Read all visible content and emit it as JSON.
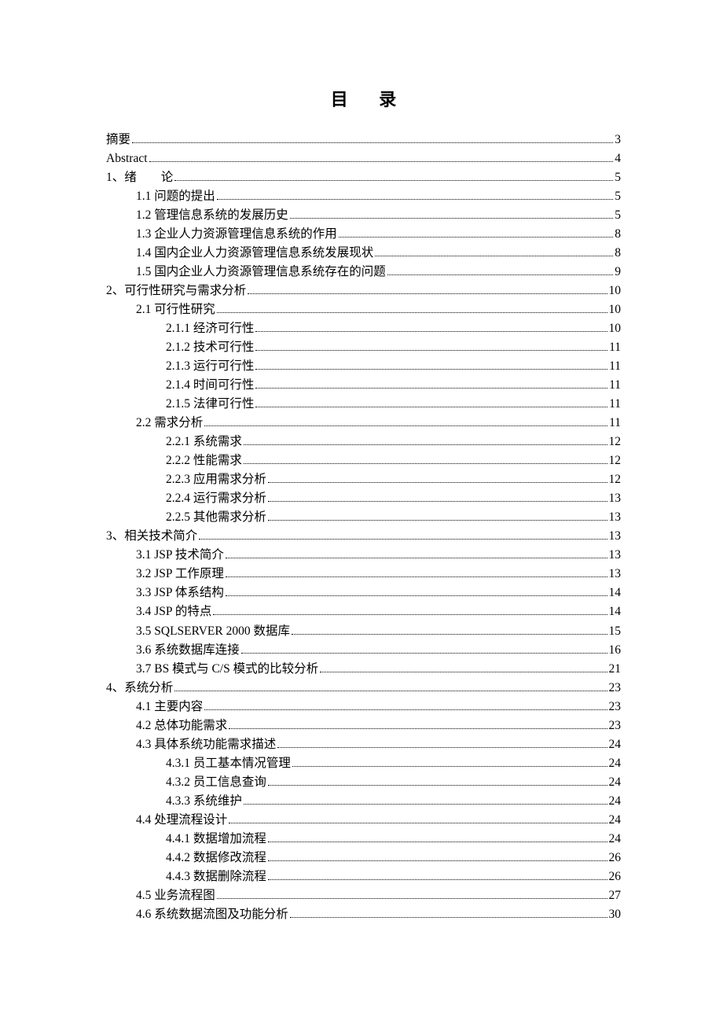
{
  "title": "目录",
  "entries": [
    {
      "label": "摘要",
      "page": "3",
      "level": 0
    },
    {
      "label": "Abstract",
      "page": "4",
      "level": 0
    },
    {
      "label": "1、绪　　论",
      "page": "5",
      "level": 0
    },
    {
      "label": "1.1  问题的提出",
      "page": "5",
      "level": 1
    },
    {
      "label": "1.2  管理信息系统的发展历史",
      "page": "5",
      "level": 1
    },
    {
      "label": "1.3  企业人力资源管理信息系统的作用",
      "page": "8",
      "level": 1
    },
    {
      "label": "1.4  国内企业人力资源管理信息系统发展现状",
      "page": "8",
      "level": 1
    },
    {
      "label": "1.5  国内企业人力资源管理信息系统存在的问题",
      "page": "9",
      "level": 1
    },
    {
      "label": "2、可行性研究与需求分析",
      "page": "10",
      "level": 0
    },
    {
      "label": "2.1  可行性研究",
      "page": "10",
      "level": 1
    },
    {
      "label": "2.1.1  经济可行性",
      "page": "10",
      "level": 2
    },
    {
      "label": "2.1.2  技术可行性",
      "page": "11",
      "level": 2
    },
    {
      "label": "2.1.3  运行可行性",
      "page": "11",
      "level": 2
    },
    {
      "label": "2.1.4  时间可行性",
      "page": "11",
      "level": 2
    },
    {
      "label": "2.1.5  法律可行性",
      "page": "11",
      "level": 2
    },
    {
      "label": "2.2  需求分析",
      "page": "11",
      "level": 1
    },
    {
      "label": "2.2.1  系统需求",
      "page": "12",
      "level": 2
    },
    {
      "label": "2.2.2  性能需求",
      "page": "12",
      "level": 2
    },
    {
      "label": "2.2.3  应用需求分析",
      "page": "12",
      "level": 2
    },
    {
      "label": "2.2.4  运行需求分析",
      "page": "13",
      "level": 2
    },
    {
      "label": "2.2.5  其他需求分析",
      "page": "13",
      "level": 2
    },
    {
      "label": "3、相关技术简介",
      "page": "13",
      "level": 0
    },
    {
      "label": "3.1 JSP 技术简介",
      "page": "13",
      "level": 1
    },
    {
      "label": "3.2 JSP 工作原理",
      "page": "13",
      "level": 1
    },
    {
      "label": "3.3 JSP 体系结构",
      "page": "14",
      "level": 1
    },
    {
      "label": "3.4 JSP 的特点",
      "page": "14",
      "level": 1
    },
    {
      "label": "3.5 SQLSERVER 2000  数据库",
      "page": "15",
      "level": 1
    },
    {
      "label": "3.6  系统数据库连接",
      "page": "16",
      "level": 1
    },
    {
      "label": "3.7 BS 模式与 C/S 模式的比较分析",
      "page": "21",
      "level": 1
    },
    {
      "label": "4、系统分析",
      "page": "23",
      "level": 0
    },
    {
      "label": "4.1  主要内容",
      "page": "23",
      "level": 1
    },
    {
      "label": "4.2  总体功能需求",
      "page": "23",
      "level": 1
    },
    {
      "label": "4.3  具体系统功能需求描述",
      "page": "24",
      "level": 1
    },
    {
      "label": "4.3.1  员工基本情况管理",
      "page": "24",
      "level": 2
    },
    {
      "label": "4.3.2  员工信息查询",
      "page": "24",
      "level": 2
    },
    {
      "label": "4.3.3  系统维护",
      "page": "24",
      "level": 2
    },
    {
      "label": "4.4  处理流程设计",
      "page": "24",
      "level": 1
    },
    {
      "label": "4.4.1  数据增加流程",
      "page": "24",
      "level": 2
    },
    {
      "label": "4.4.2  数据修改流程",
      "page": "26",
      "level": 2
    },
    {
      "label": "4.4.3  数据删除流程",
      "page": "26",
      "level": 2
    },
    {
      "label": "4.5  业务流程图",
      "page": "27",
      "level": 1
    },
    {
      "label": "4.6 系统数据流图及功能分析",
      "page": "30",
      "level": 1
    }
  ]
}
